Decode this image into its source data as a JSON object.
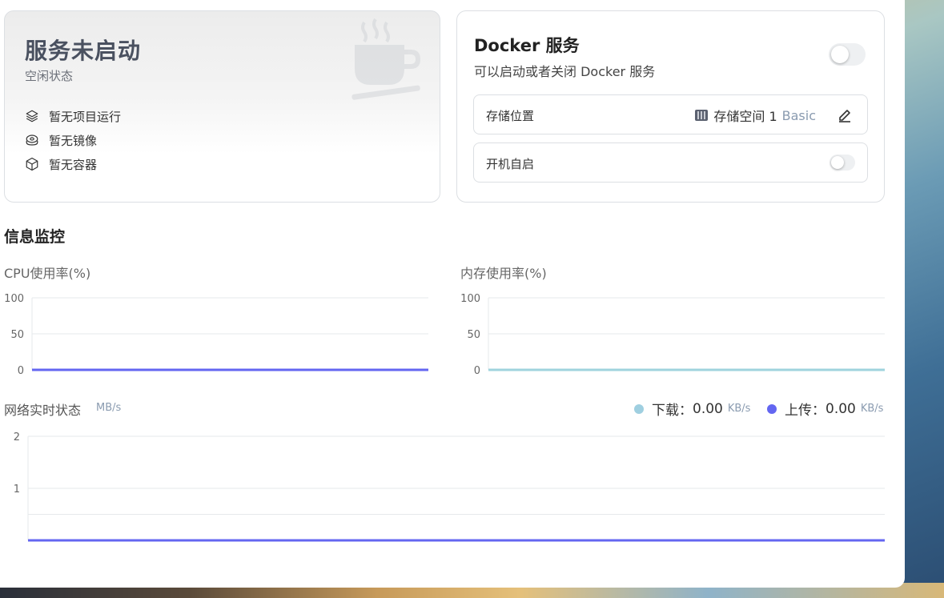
{
  "status": {
    "title": "服务未启动",
    "subtitle": "空闲状态",
    "items": [
      {
        "icon": "layers-icon",
        "label": "暂无项目运行"
      },
      {
        "icon": "disc-icon",
        "label": "暂无镜像"
      },
      {
        "icon": "box-icon",
        "label": "暂无容器"
      }
    ]
  },
  "docker": {
    "title": "Docker 服务",
    "subtitle": "可以启动或者关闭 Docker 服务",
    "service_enabled": false,
    "storage": {
      "label": "存储位置",
      "value": "存储空间 1",
      "tag": "Basic"
    },
    "autostart": {
      "label": "开机自启",
      "enabled": false
    }
  },
  "monitor": {
    "section_title": "信息监控",
    "cpu": {
      "label": "CPU使用率(%)"
    },
    "memory": {
      "label": "内存使用率(%)"
    },
    "network": {
      "label": "网络实时状态",
      "unit": "MB/s",
      "download": {
        "label": "下载：",
        "value": "0.00",
        "unit": "KB/s",
        "color": "#9fcfe0"
      },
      "upload": {
        "label": "上传：",
        "value": "0.00",
        "unit": "KB/s",
        "color": "#6366f1"
      }
    }
  },
  "chart_data": [
    {
      "type": "line",
      "ylim": [
        0,
        100
      ],
      "yticks": [
        "100",
        "50",
        "0"
      ],
      "series": [
        {
          "values": [
            0,
            0,
            0,
            0,
            0,
            0,
            0,
            0,
            0,
            0,
            0,
            0
          ],
          "color": "#6366f1"
        }
      ],
      "grid": true
    },
    {
      "type": "line",
      "ylim": [
        0,
        100
      ],
      "yticks": [
        "100",
        "50",
        "0"
      ],
      "series": [
        {
          "values": [
            0,
            0,
            0,
            0,
            0,
            0,
            0,
            0,
            0,
            0,
            0,
            0
          ],
          "color": "#9fd3dd"
        }
      ],
      "grid": true
    },
    {
      "type": "line",
      "ylim": [
        0,
        2
      ],
      "yticks": [
        "2",
        "1"
      ],
      "series": [
        {
          "values": [
            0,
            0,
            0,
            0,
            0,
            0,
            0,
            0,
            0,
            0,
            0,
            0
          ],
          "color": "#9fcfe0"
        },
        {
          "values": [
            0,
            0,
            0,
            0,
            0,
            0,
            0,
            0,
            0,
            0,
            0,
            0
          ],
          "color": "#6366f1"
        }
      ],
      "grid": true
    }
  ]
}
